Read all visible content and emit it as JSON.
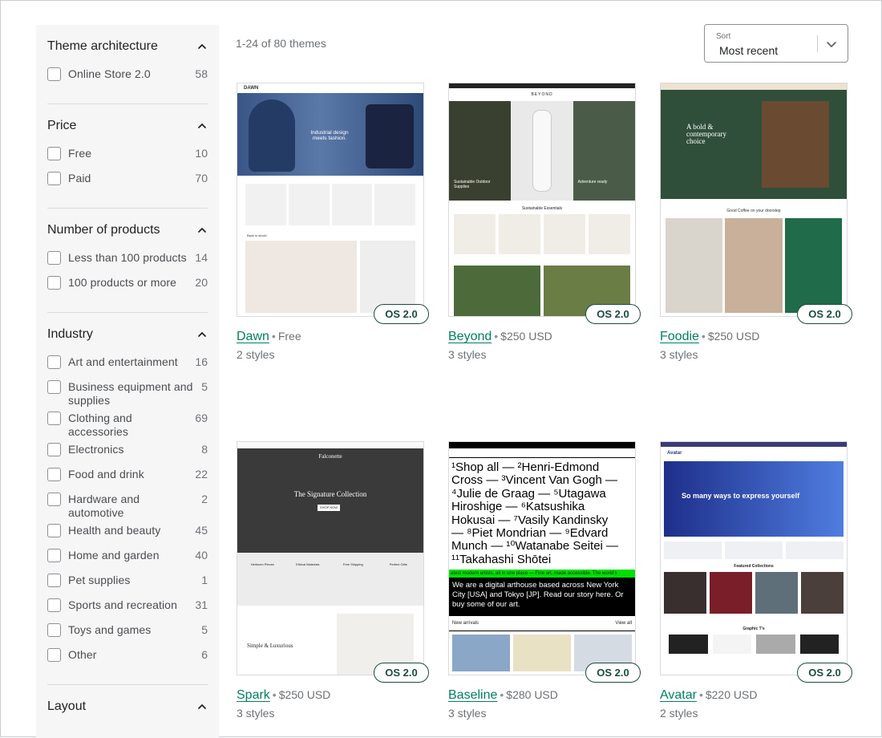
{
  "filters": [
    {
      "title": "Theme architecture",
      "options": [
        {
          "label": "Online Store 2.0",
          "count": "58"
        }
      ]
    },
    {
      "title": "Price",
      "options": [
        {
          "label": "Free",
          "count": "10"
        },
        {
          "label": "Paid",
          "count": "70"
        }
      ]
    },
    {
      "title": "Number of products",
      "options": [
        {
          "label": "Less than 100 products",
          "count": "14"
        },
        {
          "label": "100 products or more",
          "count": "20"
        }
      ]
    },
    {
      "title": "Industry",
      "options": [
        {
          "label": "Art and entertainment",
          "count": "16"
        },
        {
          "label": "Business equipment and supplies",
          "count": "5"
        },
        {
          "label": "Clothing and accessories",
          "count": "69"
        },
        {
          "label": "Electronics",
          "count": "8"
        },
        {
          "label": "Food and drink",
          "count": "22"
        },
        {
          "label": "Hardware and automotive",
          "count": "2"
        },
        {
          "label": "Health and beauty",
          "count": "45"
        },
        {
          "label": "Home and garden",
          "count": "40"
        },
        {
          "label": "Pet supplies",
          "count": "1"
        },
        {
          "label": "Sports and recreation",
          "count": "31"
        },
        {
          "label": "Toys and games",
          "count": "5"
        },
        {
          "label": "Other",
          "count": "6"
        }
      ]
    },
    {
      "title": "Layout",
      "options": []
    }
  ],
  "results_count": "1-24 of 80 themes",
  "sort": {
    "label": "Sort",
    "value": "Most recent"
  },
  "themes": [
    {
      "name": "Dawn",
      "price": "Free",
      "styles": "2 styles",
      "badge": "OS 2.0",
      "hero": "Industrial design meets fashion.",
      "accent": "#3d5a8a"
    },
    {
      "name": "Beyond",
      "price": "$250 USD",
      "styles": "3 styles",
      "badge": "OS 2.0",
      "hero": "Sustainable Essentials",
      "accent": "#2b3b2e"
    },
    {
      "name": "Foodie",
      "price": "$250 USD",
      "styles": "3 styles",
      "badge": "OS 2.0",
      "hero": "A bold & contemporary choice",
      "accent": "#2f4f3a"
    },
    {
      "name": "Spark",
      "price": "$250 USD",
      "styles": "3 styles",
      "badge": "OS 2.0",
      "hero": "The Signature Collection",
      "accent": "#2a2a2a"
    },
    {
      "name": "Baseline",
      "price": "$280 USD",
      "styles": "3 styles",
      "badge": "OS 2.0",
      "hero": "Shop all",
      "accent": "#00e000"
    },
    {
      "name": "Avatar",
      "price": "$220 USD",
      "styles": "2 styles",
      "badge": "OS 2.0",
      "hero": "So many ways to express yourself",
      "accent": "#2f55c8"
    }
  ],
  "preview_text": {
    "dawn_brand": "DAWN",
    "dawn_sub": "Back in stock!",
    "beyond_brand": "BEYOND",
    "beyond_sub": "Sustainable Outdoor Supplies",
    "beyond_sub2": "Adventure ready",
    "foodie_sub": "Good Coffee on your doorstep",
    "spark_brand": "Falconette",
    "spark_cta": "SHOP NOW",
    "spark_cols": [
      "Heirloom Pieces",
      "Ethical Materials",
      "Free Shipping",
      "Perfect Gifts"
    ],
    "spark_section": "Simple & Luxurious",
    "baseline_lines": [
      "¹Shop all — ²Henri-Edmond",
      "Cross — ³Vincent Van Gogh —",
      "⁴Julie de Graag — ⁵Utagawa",
      "Hiroshige — ⁶Katsushika",
      "Hokusai — ⁷Vasily Kandinsky",
      "— ⁸Piet Mondrian — ⁹Edvard",
      "Munch — ¹⁰Watanabe Seitei —",
      "¹¹Takahashi Shōtei"
    ],
    "baseline_ticker": "atest modern artists, all in one place — Fine art, made accessible. The world's",
    "baseline_about": "We are a digital arthouse based across New York City [USA] and Tokyo [JP]. Read our story here. Or buy some of our art.",
    "baseline_new": "New arrivals",
    "baseline_view": "View all",
    "avatar_brand": "Avatar",
    "avatar_featured": "Featured Collections",
    "avatar_graphic": "Graphic T's"
  }
}
